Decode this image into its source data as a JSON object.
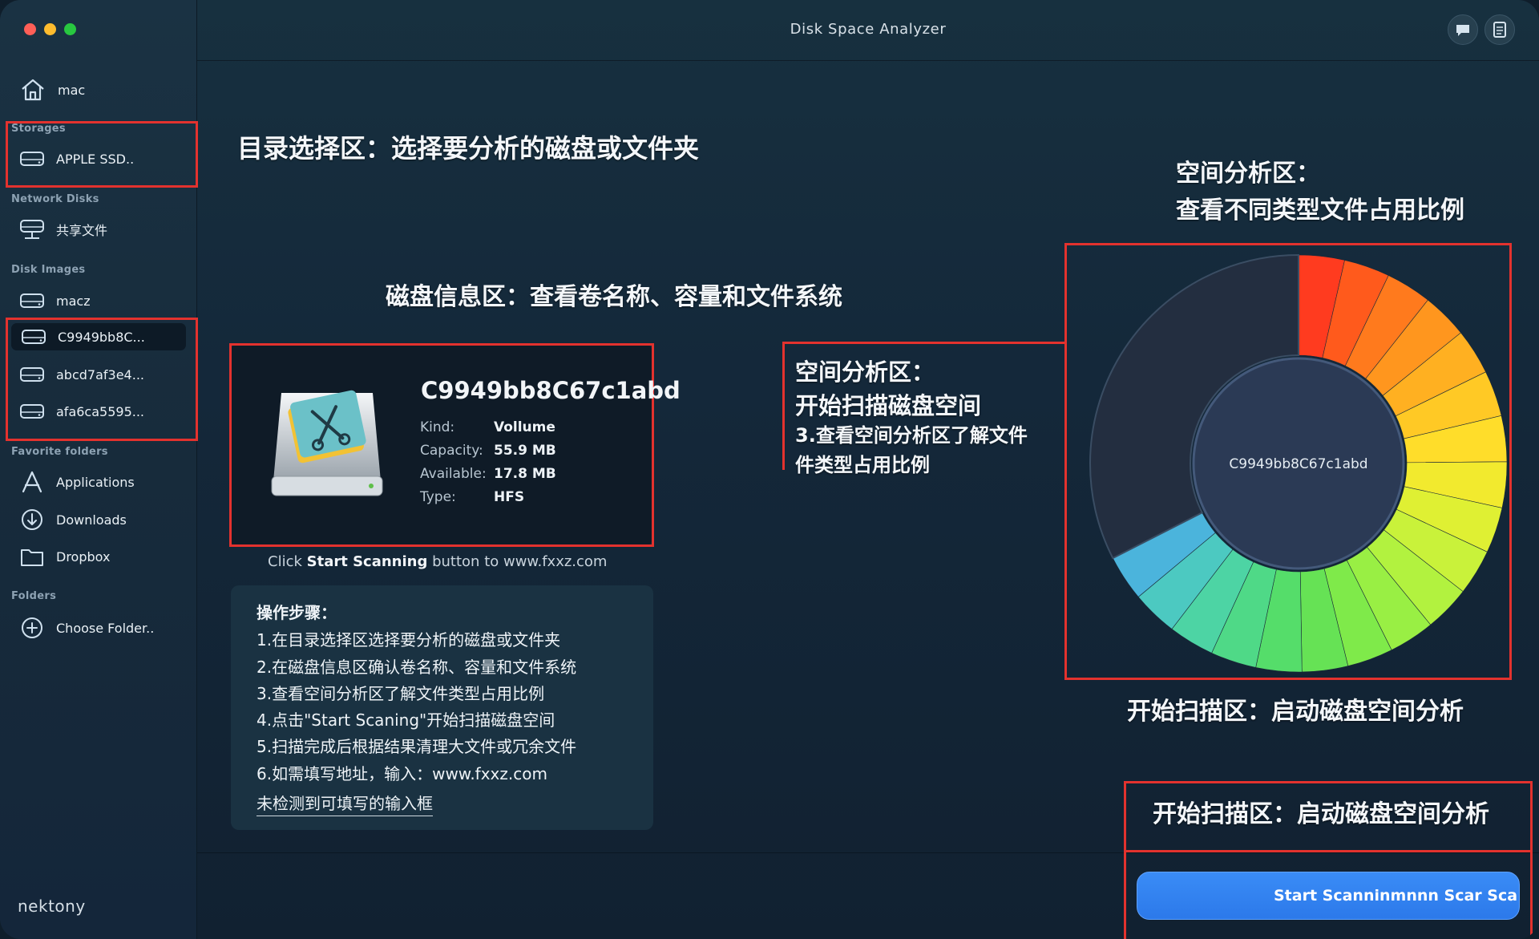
{
  "window": {
    "title": "Disk Space Analyzer",
    "brand": "nektony"
  },
  "sidebar": {
    "home": {
      "label": "mac",
      "icon": "home-icon"
    },
    "sections": {
      "storages": "Storages",
      "network": "Network Disks",
      "images": "Disk Images",
      "favorites": "Favorite folders",
      "folders": "Folders"
    },
    "storages": [
      {
        "label": "APPLE SSD..",
        "icon": "disk-icon"
      }
    ],
    "network": [
      {
        "label": "共享文件",
        "icon": "network-disk-icon"
      }
    ],
    "images": [
      {
        "label": "macz",
        "icon": "disk-icon"
      },
      {
        "label": "C9949bb8C...",
        "icon": "disk-icon",
        "selected": true
      },
      {
        "label": "abcd7af3e4...",
        "icon": "disk-icon"
      },
      {
        "label": "afa6ca5595...",
        "icon": "disk-icon"
      }
    ],
    "favorites": [
      {
        "label": "Applications",
        "icon": "applications-icon"
      },
      {
        "label": "Downloads",
        "icon": "downloads-icon"
      },
      {
        "label": "Dropbox",
        "icon": "folder-icon"
      }
    ],
    "folders": [
      {
        "label": "Choose Folder..",
        "icon": "add-icon"
      }
    ]
  },
  "annotations": {
    "dir_select": "目录选择区：选择要分析的磁盘或文件夹",
    "disk_info": "磁盘信息区：查看卷名称、容量和文件系统",
    "space_analysis_1": "空间分析区：",
    "space_analysis_2": "查看不同类型文件占用比例",
    "middle_1": "空间分析区：",
    "middle_2": "开始扫描磁盘空间",
    "middle_3": "3.查看空间分析区了解文件",
    "middle_4": "件类型占用比例",
    "start_scan_1": "开始扫描区：启动磁盘空间分析",
    "start_scan_2": "开始扫描区：启动磁盘空间分析"
  },
  "disk": {
    "name": "C9949bb8C67c1abd",
    "kind_label": "Kind:",
    "kind": "Vollume",
    "capacity_label": "Capacity:",
    "capacity": "55.9 MB",
    "available_label": "Available:",
    "available": "17.8 MB",
    "type_label": "Type:",
    "type": "HFS"
  },
  "hint": {
    "prefix": "Click ",
    "bold": "Start Scanning",
    "suffix": " button to  www.fxxz.com"
  },
  "steps": {
    "title": "操作步骤：",
    "items": [
      "1.在目录选择区选择要分析的磁盘或文件夹",
      "2.在磁盘信息区确认卷名称、容量和文件系统",
      "3.查看空间分析区了解文件类型占用比例",
      "4.点击\"Start Scaning\"开始扫描磁盘空间",
      "5.扫描完成后根据结果清理大文件或冗余文件",
      "6.如需填写地址，输入：www.fxxz.com"
    ],
    "note": "未检测到可填写的输入框"
  },
  "chart": {
    "center_label": "C9949bb8C67c1abd",
    "free_color": "#232e40",
    "segment_colors": [
      "#ff3b1f",
      "#ff5a1c",
      "#ff7a1d",
      "#ff961e",
      "#ffb021",
      "#ffc925",
      "#ffdd2a",
      "#f2ea2e",
      "#dff033",
      "#c9f23a",
      "#b2f23f",
      "#99ef44",
      "#7fea4a",
      "#66e255",
      "#55dd6a",
      "#4fd987",
      "#4dd4a4",
      "#4cc9c1",
      "#4bb4dc"
    ]
  },
  "start_button": {
    "label": "Start Scanninmnnn Scar Sca"
  }
}
